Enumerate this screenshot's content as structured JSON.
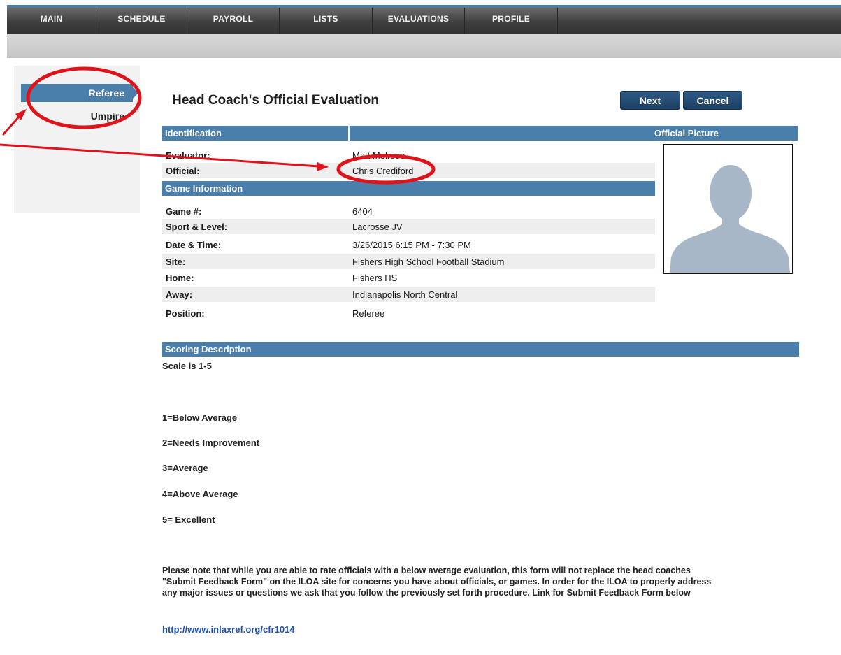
{
  "nav": {
    "items": [
      {
        "label": "MAIN"
      },
      {
        "label": "SCHEDULE"
      },
      {
        "label": "PAYROLL"
      },
      {
        "label": "LISTS"
      },
      {
        "label": "EVALUATIONS"
      },
      {
        "label": "PROFILE"
      }
    ]
  },
  "sidebar": {
    "items": [
      {
        "label": "Referee",
        "active": true
      },
      {
        "label": "Umpire",
        "active": false
      }
    ]
  },
  "page": {
    "title": "Head Coach's Official Evaluation"
  },
  "buttons": {
    "next": "Next",
    "cancel": "Cancel"
  },
  "identification": {
    "header": "Identification",
    "evaluator_label": "Evaluator:",
    "evaluator_value": "Matt Melrose",
    "official_label": "Official:",
    "official_value": "Chris Crediford"
  },
  "picture": {
    "header": "Official Picture"
  },
  "game": {
    "header": "Game Information",
    "rows": [
      {
        "label": "Game #:",
        "value": "6404"
      },
      {
        "label": "Sport & Level:",
        "value": "Lacrosse JV"
      },
      {
        "label": "Date & Time:",
        "value": "3/26/2015 6:15 PM - 7:30 PM"
      },
      {
        "label": "Site:",
        "value": "Fishers High School Football Stadium"
      },
      {
        "label": "Home:",
        "value": "Fishers HS"
      },
      {
        "label": "Away:",
        "value": "Indianapolis North Central"
      },
      {
        "label": "Position:",
        "value": "Referee"
      }
    ]
  },
  "scoring": {
    "header": "Scoring Description",
    "scale": "Scale is 1-5",
    "levels": [
      "1=Below Average",
      "2=Needs Improvement",
      "3=Average",
      "4=Above Average",
      "5= Excellent"
    ],
    "note_lines": [
      "Please note that while you are able to rate officials with a below average evaluation, this form will not replace the head coaches",
      "\"Submit Feedback Form\" on the ILOA site for concerns you have about officials, or games. In order for the ILOA to properly address",
      "any major issues or questions we ask that you follow the previously set forth procedure. Link for Submit Feedback Form below"
    ],
    "link": "http://www.inlaxref.org/cfr1014"
  },
  "colors": {
    "accent": "#4a7fab",
    "annotation": "#e0121a",
    "button": "#1c3f63"
  }
}
